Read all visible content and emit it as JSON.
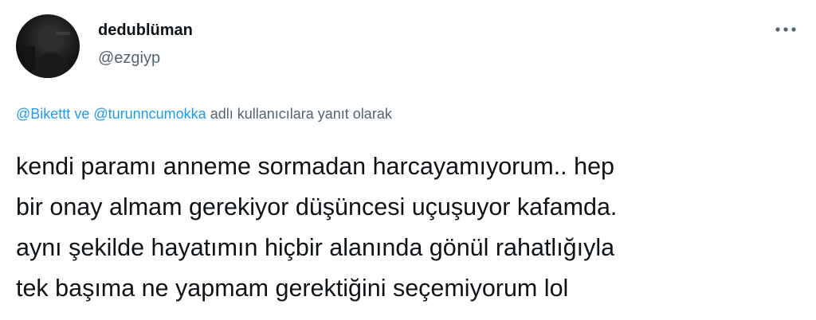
{
  "author": {
    "display_name": "dedublüman",
    "handle": "@ezgiyp",
    "avatar_icon": "profile-photo-dark"
  },
  "more_icon": "more-horizontal-icon",
  "reply_context": {
    "mention_1": "@Bikettt",
    "connector": "ve",
    "mention_2": "@turunncumokka",
    "suffix": "adlı kullanıcılara yanıt olarak"
  },
  "tweet": {
    "lines": [
      "kendi paramı anneme sormadan harcayamıyorum.. hep",
      "bir onay almam gerekiyor düşüncesi uçuşuyor kafamda.",
      "aynı şekilde hayatımın hiçbir alanında gönül rahatlığıyla",
      "tek başıma ne yapmam gerektiğini seçemiyorum lol"
    ]
  },
  "colors": {
    "link": "#1d9bf0",
    "secondary_text": "#536471",
    "primary_text": "#0f1419",
    "background": "#ffffff"
  }
}
